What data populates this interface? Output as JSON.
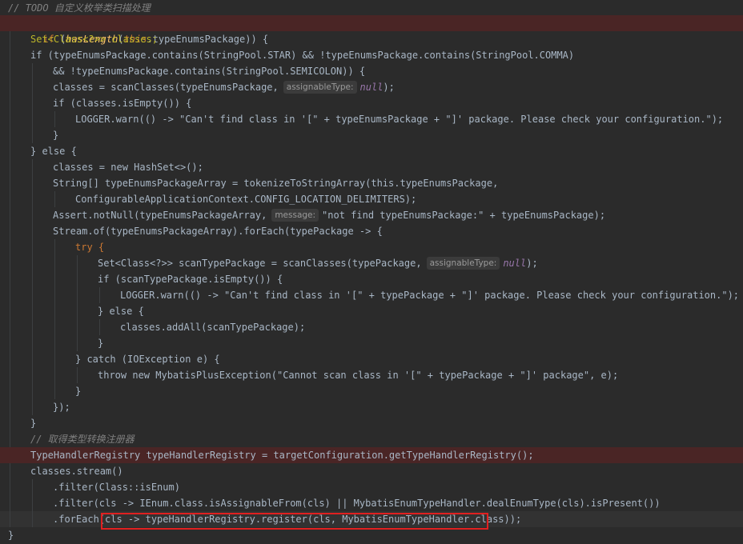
{
  "editor": {
    "comment_top": "// TODO 自定义枚举类扫描处理",
    "comment_registry": "// 取得类型转换注册器",
    "lines": {
      "l2_if": "if",
      "l2_hasLength": "hasLength",
      "l2_this": "this",
      "l2_rest": ".typeEnumsPackage)) {",
      "l3_set": "Set<Class<?>> classes;",
      "l4": "if (typeEnumsPackage.contains(StringPool.STAR) && !typeEnumsPackage.contains(StringPool.COMMA)",
      "l5": "&& !typeEnumsPackage.contains(StringPool.SEMICOLON)) {",
      "l6_a": "classes = scanClasses(typeEnumsPackage,",
      "l6_hint": "assignableType:",
      "l6_null": "null",
      "l6_end": ");",
      "l7": "if (classes.isEmpty()) {",
      "l8": "LOGGER.warn(() -> \"Can't find class in '[\" + typeEnumsPackage + \"]' package. Please check your configuration.\");",
      "l9": "}",
      "l10": "} else {",
      "l11": "classes = new HashSet<>();",
      "l12": "String[] typeEnumsPackageArray = tokenizeToStringArray(this.typeEnumsPackage,",
      "l13": "ConfigurableApplicationContext.CONFIG_LOCATION_DELIMITERS);",
      "l14_a": "Assert.notNull(typeEnumsPackageArray,",
      "l14_hint": "message:",
      "l14_b": "\"not find typeEnumsPackage:\" + typeEnumsPackage);",
      "l15": "Stream.of(typeEnumsPackageArray).forEach(typePackage -> {",
      "l16": "try {",
      "l17_a": "Set<Class<?>> scanTypePackage = scanClasses(typePackage,",
      "l17_hint": "assignableType:",
      "l17_null": "null",
      "l17_end": ");",
      "l18": "if (scanTypePackage.isEmpty()) {",
      "l19": "LOGGER.warn(() -> \"Can't find class in '[\" + typePackage + \"]' package. Please check your configuration.\");",
      "l20": "} else {",
      "l21": "classes.addAll(scanTypePackage);",
      "l22": "}",
      "l23": "} catch (IOException e) {",
      "l24": "throw new MybatisPlusException(\"Cannot scan class in '[\" + typePackage + \"]' package\", e);",
      "l25": "}",
      "l26": "});",
      "l27": "}",
      "l29": "TypeHandlerRegistry typeHandlerRegistry = targetConfiguration.getTypeHandlerRegistry();",
      "l30": "classes.stream()",
      "l31": ".filter(Class::isEnum)",
      "l32": ".filter(cls -> IEnum.class.isAssignableFrom(cls) || MybatisEnumTypeHandler.dealEnumType(cls).isPresent())",
      "l33": ".forEach(cls -> typeHandlerRegistry.register(cls, MybatisEnumTypeHandler.class));",
      "l34": "}"
    }
  },
  "colors": {
    "background": "#2b2b2b",
    "keyword": "#cc7832",
    "method": "#ffc66d",
    "string": "#6a8759",
    "field": "#9876aa",
    "comment": "#808080",
    "highlight_box": "#e02020"
  }
}
